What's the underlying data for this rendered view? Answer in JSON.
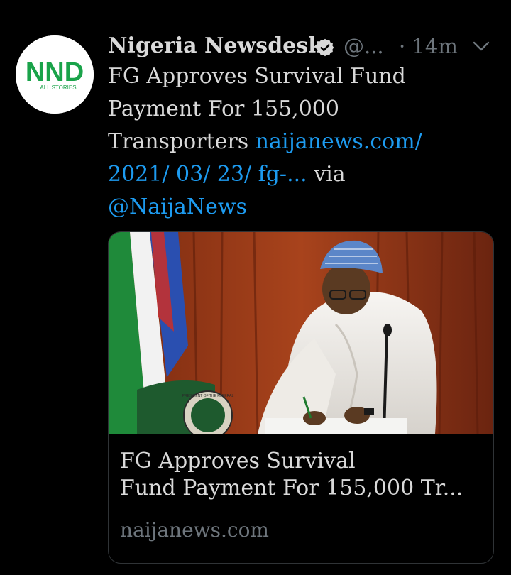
{
  "tweet": {
    "display_name": "Nigeria Newsdesk",
    "handle": "@...",
    "time": "· 14m",
    "text_plain": "FG Approves Survival Fund Payment For 155,000 Transporters ",
    "link_text": "naijanews.com/ 2021/ 03/ 23/ fg-...",
    "via_text": " via ",
    "mention": "@NaijaNews"
  },
  "avatar": {
    "logo_text": "NND",
    "logo_subtext": "ALL STORIES",
    "logo_color": "#1aa34a"
  },
  "card": {
    "title_line1": "FG Approves Survival",
    "title_line2": "Fund Payment For 155,000 Tr...",
    "domain": "naijanews.com",
    "seal_text": "PRESIDENT OF THE FEDERAL"
  },
  "icons": {
    "verified": "verified-badge-icon",
    "more": "chevron-down-icon"
  },
  "colors": {
    "background": "#000000",
    "text": "#d9d9d9",
    "muted": "#6e767d",
    "link": "#1d9bf0",
    "border": "#2f3336"
  }
}
